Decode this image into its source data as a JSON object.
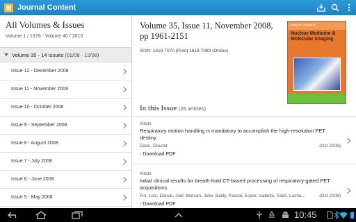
{
  "app": {
    "title": "Journal Content"
  },
  "toolbar_icons": [
    "download-icon",
    "search-icon",
    "overflow-menu-icon"
  ],
  "sidebar": {
    "title": "All Volumes & Issues",
    "subtitle": "Volume 1 / 1976 - Volume 40 / 2013",
    "volume_label": "Volume 35 - 14 Issues",
    "volume_range": "(01/08  -  12/08)",
    "issues": [
      "Issue 12 - December 2008",
      "Issue 11 - November 2008",
      "Issue 10 - October 2008",
      "Issue 9 - September 2008",
      "Issue 8 - August 2008",
      "Issue 7 - July 2008",
      "Issue 6 - June 2008",
      "Issue 5 - May 2008"
    ]
  },
  "main": {
    "issue_title": "Volume 35, Issue 11, November 2008, pp 1961-2151",
    "issn": "ISSN: 1619-7070 (Print) 1619-7089 (Online)",
    "cover": {
      "top_text": "European Journal of",
      "journal_name": "Nuclear Medicine & Molecular Imaging"
    },
    "section_title": "In this Issue",
    "section_count": "(26 articles)",
    "articles": [
      {
        "type": "Article",
        "title": "Respiratory motion handling is mandatory to accomplish the high-resolution PET destiny",
        "authors": "Daou, Doumit",
        "date": "(Oct 2008)",
        "download": "Download PDF"
      },
      {
        "type": "Article",
        "title": "Initial clinical results for breath-hold CT-based processing of respiratory-gated PET acquisitions",
        "authors": "Fin, Loïc, Daouk, Joël, Morvan, Julie, Bailly, Pascal, Esper, Isabelle, Saidi, Lazha...",
        "date": "(Oct 2008)",
        "download": "Download PDF"
      }
    ]
  },
  "system_bar": {
    "time": "10:45",
    "nav_icons": [
      "back-icon",
      "home-icon",
      "recent-apps-icon"
    ],
    "tray_icons": [
      "usb-icon",
      "recycle-icon",
      "android-icon",
      "sd-card-icon",
      "bluetooth-icon",
      "wifi-icon",
      "battery-icon"
    ]
  },
  "colors": {
    "actionbar": "#1e82c4",
    "cover": "#e8772e"
  }
}
